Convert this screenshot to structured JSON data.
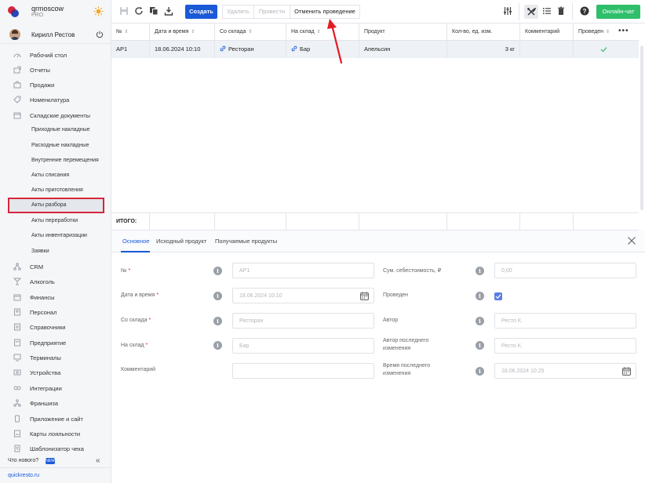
{
  "brand": {
    "name": "qrmoscow",
    "plan": "PRO"
  },
  "user": {
    "name": "Кирилл Рестов"
  },
  "nav": [
    {
      "label": "Рабочий стол",
      "icon": "dashboard-icon"
    },
    {
      "label": "Отчеты",
      "icon": "reports-icon"
    },
    {
      "label": "Продажи",
      "icon": "sales-icon"
    },
    {
      "label": "Номенклатура",
      "icon": "tag-icon"
    },
    {
      "label": "Складские документы",
      "icon": "warehouse-icon"
    }
  ],
  "subnav": [
    {
      "label": "Приходные накладные"
    },
    {
      "label": "Расходные накладные"
    },
    {
      "label": "Внутренние перемещения"
    },
    {
      "label": "Акты списания"
    },
    {
      "label": "Акты приготовления"
    },
    {
      "label": "Акты разбора"
    },
    {
      "label": "Акты переработки"
    },
    {
      "label": "Акты инвентаризации"
    },
    {
      "label": "Заявки"
    }
  ],
  "nav2": [
    {
      "label": "CRM",
      "icon": "crm-icon"
    },
    {
      "label": "Алкоголь",
      "icon": "alcohol-icon"
    },
    {
      "label": "Финансы",
      "icon": "finance-icon"
    },
    {
      "label": "Персонал",
      "icon": "staff-icon"
    },
    {
      "label": "Справочники",
      "icon": "reference-icon"
    },
    {
      "label": "Предприятие",
      "icon": "enterprise-icon"
    },
    {
      "label": "Терминалы",
      "icon": "terminal-icon"
    },
    {
      "label": "Устройства",
      "icon": "devices-icon"
    },
    {
      "label": "Интеграции",
      "icon": "integrations-icon"
    },
    {
      "label": "Франшиза",
      "icon": "franchise-icon"
    },
    {
      "label": "Приложение и сайт",
      "icon": "app-icon"
    },
    {
      "label": "Карты лояльности",
      "icon": "loyalty-icon"
    },
    {
      "label": "Шаблонизатор чека",
      "icon": "receipt-icon"
    }
  ],
  "footer": {
    "whats_new": "Что нового?",
    "new_badge": "NEW",
    "site": "quickresto.ru"
  },
  "toolbar": {
    "create": "Создать",
    "delete": "Удалить",
    "post": "Провести",
    "unpost": "Отменить проведение",
    "chat": "Онлайн-чат"
  },
  "table": {
    "headers": [
      "№",
      "Дата и время",
      "Со склада",
      "На склад",
      "Продукт",
      "Кол-во, ед. изм.",
      "Комментарий",
      "Проведен"
    ],
    "row": {
      "num": "AP1",
      "datetime": "18.06.2024 10:10",
      "from": "Ресторан",
      "to": "Бар",
      "product": "Апельсин",
      "qty": "3 кг",
      "comment": "",
      "posted": true
    },
    "total_label": "ИТОГО:"
  },
  "detail": {
    "tabs": [
      "Основное",
      "Исходный продукт",
      "Получаемые продукты"
    ],
    "fields_left": [
      {
        "label": "№",
        "required": true,
        "value": "AP1"
      },
      {
        "label": "Дата и время",
        "required": true,
        "value": "18.06.2024 10:10"
      },
      {
        "label": "Со склада",
        "required": true,
        "value": "Ресторан"
      },
      {
        "label": "На склад",
        "required": true,
        "value": "Бар"
      },
      {
        "label": "Комментарий",
        "required": false,
        "value": ""
      }
    ],
    "fields_right": [
      {
        "label": "Сум. себестоимость, ₽",
        "value": "0,00"
      },
      {
        "label": "Проведен",
        "value": ""
      },
      {
        "label": "Автор",
        "value": "Ресто К."
      },
      {
        "label_line1": "Автор последнего",
        "label_line2": "изменения",
        "value": "Ресто К."
      },
      {
        "label_line1": "Время последнего",
        "label_line2": "изменения",
        "value": "18.06.2024 10:25"
      }
    ]
  },
  "colors": {
    "accent": "#1a5ad7",
    "chat": "#2fbf6b",
    "highlight": "#d7263d",
    "arrow": "#e21b23"
  }
}
